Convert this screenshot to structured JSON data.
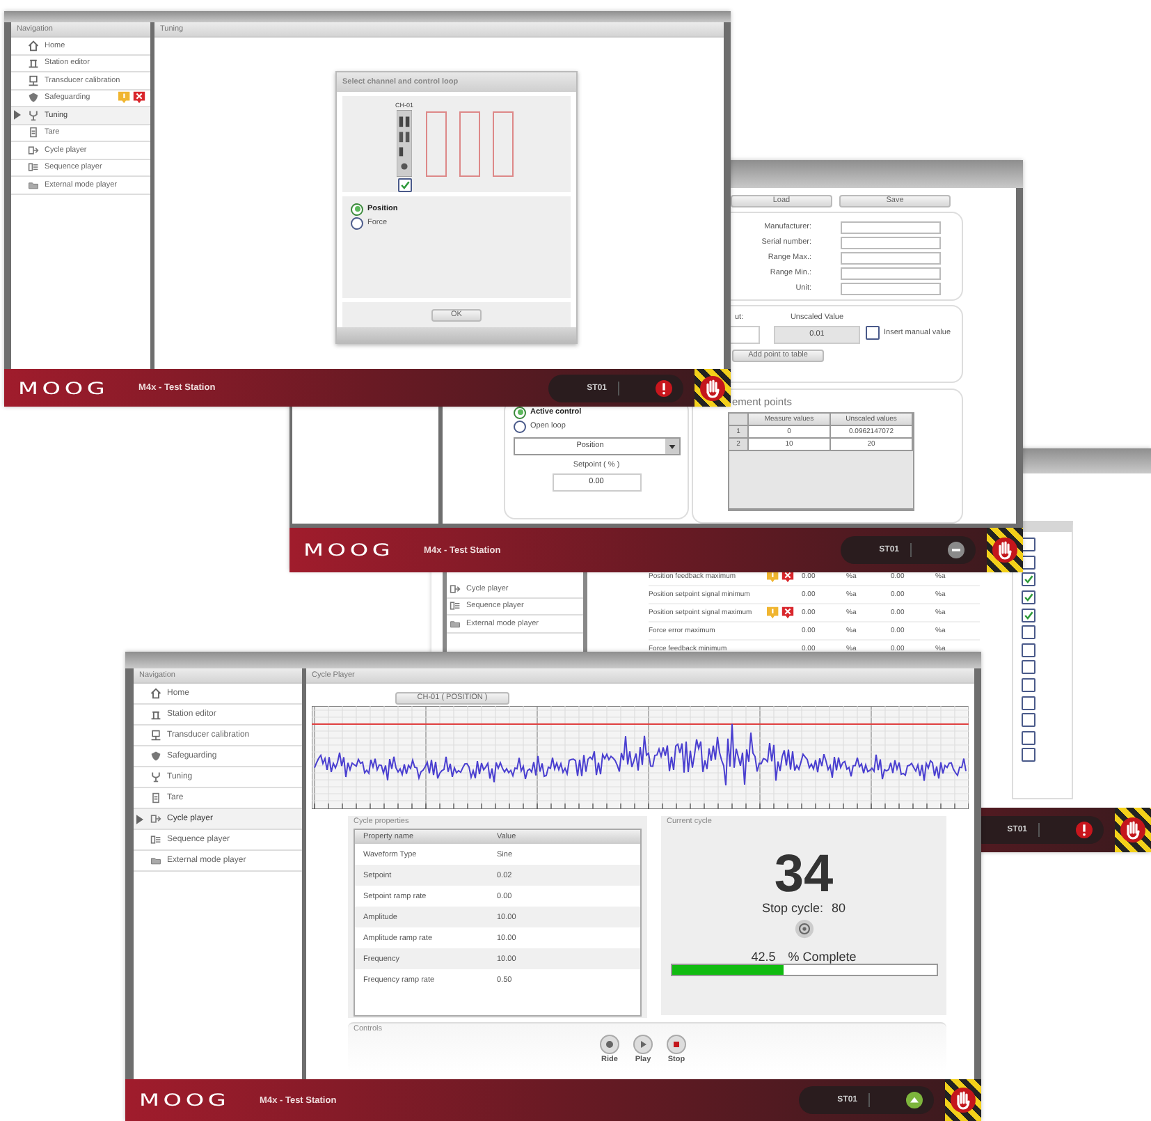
{
  "tuning_window": {
    "nav_title": "Navigation",
    "panel_title": "Tuning",
    "nav_items": [
      {
        "label": "Home",
        "selected": false,
        "alerts": false
      },
      {
        "label": "Station editor",
        "selected": false,
        "alerts": false
      },
      {
        "label": "Transducer calibration",
        "selected": false,
        "alerts": false
      },
      {
        "label": "Safeguarding",
        "selected": false,
        "alerts": true
      },
      {
        "label": "Tuning",
        "selected": true,
        "alerts": false
      },
      {
        "label": "Tare",
        "selected": false,
        "alerts": false
      },
      {
        "label": "Cycle player",
        "selected": false,
        "alerts": false
      },
      {
        "label": "Sequence player",
        "selected": false,
        "alerts": false
      },
      {
        "label": "External mode player",
        "selected": false,
        "alerts": false
      }
    ],
    "dialog": {
      "title": "Select channel and control loop",
      "channel": {
        "label": "CH-01",
        "checked": true
      },
      "radios": [
        {
          "label": "Position",
          "selected": true
        },
        {
          "label": "Force",
          "selected": false
        }
      ],
      "ok": "OK"
    },
    "footer": {
      "logo": "MOOG",
      "title": "M4x - Test Station",
      "station": "ST01",
      "kind": "alarm"
    }
  },
  "calibration_window": {
    "buttons": [
      "Load",
      "Save"
    ],
    "fields": [
      {
        "label": "Manufacturer:"
      },
      {
        "label": "Serial number:"
      },
      {
        "label": "Range Max.:"
      },
      {
        "label": "Range Min.:"
      },
      {
        "label": "Unit:"
      }
    ],
    "partial_label": "ut:",
    "unscaled_label": "Unscaled Value",
    "unscaled_value": "0.01",
    "manual": {
      "label": "Insert manual value",
      "checked": false
    },
    "add_button": "Add point to table",
    "points_title": "ement points",
    "columns": [
      "Measure values",
      "Unscaled values"
    ],
    "rows": [
      {
        "index": "1",
        "cells": [
          "0",
          "0.0962147072"
        ]
      },
      {
        "index": "2",
        "cells": [
          "10",
          "20"
        ]
      }
    ],
    "loop_radios": [
      {
        "label": "Active control",
        "selected": true
      },
      {
        "label": "Open loop",
        "selected": false
      }
    ],
    "loop_select": "Position",
    "setpoint_label": "Setpoint ( % )",
    "setpoint_value": "0.00",
    "footer": {
      "logo": "MOOG",
      "title": "M4x - Test Station",
      "station": "ST01",
      "kind": "idle"
    }
  },
  "safeguarding_window": {
    "nav_items": [
      {
        "label": "Cycle player"
      },
      {
        "label": "Sequence player"
      },
      {
        "label": "External mode player"
      }
    ],
    "rows": [
      {
        "name": "Position feedback maximum",
        "alerts": true,
        "values": [
          "0.00",
          "%a",
          "0.00",
          "%a"
        ]
      },
      {
        "name": "Position setpoint signal minimum",
        "alerts": false,
        "values": [
          "0.00",
          "%a",
          "0.00",
          "%a"
        ]
      },
      {
        "name": "Position setpoint signal maximum",
        "alerts": true,
        "values": [
          "0.00",
          "%a",
          "0.00",
          "%a"
        ]
      },
      {
        "name": "Force error maximum",
        "alerts": false,
        "values": [
          "0.00",
          "%a",
          "0.00",
          "%a"
        ]
      },
      {
        "name": "Force feedback minimum",
        "alerts": false,
        "values": [
          "0.00",
          "%a",
          "0.00",
          "%a"
        ]
      }
    ],
    "checks": [
      {
        "checked": false
      },
      {
        "checked": false
      },
      {
        "checked": true
      },
      {
        "checked": true
      },
      {
        "checked": true
      },
      {
        "checked": false
      },
      {
        "checked": false
      },
      {
        "checked": false
      },
      {
        "checked": false
      },
      {
        "checked": false
      },
      {
        "checked": false
      },
      {
        "checked": false
      },
      {
        "checked": false
      }
    ],
    "footer": {
      "station": "ST01",
      "kind": "alarm"
    }
  },
  "cycle_player_window": {
    "nav_title": "Navigation",
    "panel_title": "Cycle Player",
    "nav_items": [
      {
        "label": "Home",
        "selected": false
      },
      {
        "label": "Station editor",
        "selected": false
      },
      {
        "label": "Transducer calibration",
        "selected": false
      },
      {
        "label": "Safeguarding",
        "selected": false
      },
      {
        "label": "Tuning",
        "selected": false
      },
      {
        "label": "Tare",
        "selected": false
      },
      {
        "label": "Cycle player",
        "selected": true
      },
      {
        "label": "Sequence player",
        "selected": false
      },
      {
        "label": "External mode player",
        "selected": false
      }
    ],
    "channel_button": "CH-01 ( POSITION )",
    "properties_title": "Cycle properties",
    "columns": [
      "Property name",
      "Value"
    ],
    "properties": [
      {
        "name": "Waveform Type",
        "value": "Sine"
      },
      {
        "name": "Setpoint",
        "value": "0.02"
      },
      {
        "name": "Setpoint ramp rate",
        "value": "0.00"
      },
      {
        "name": "Amplitude",
        "value": "10.00"
      },
      {
        "name": "Amplitude ramp rate",
        "value": "10.00"
      },
      {
        "name": "Frequency",
        "value": "10.00"
      },
      {
        "name": "Frequency ramp rate",
        "value": "0.50"
      }
    ],
    "current_title": "Current cycle",
    "current_cycle": "34",
    "stop_label": "Stop cycle:",
    "stop_value": "80",
    "percent": "42.5",
    "percent_label": "% Complete",
    "progress": {
      "level": 0.425
    },
    "controls_title": "Controls",
    "controls": [
      {
        "label": "Ride",
        "kind": "record"
      },
      {
        "label": "Play",
        "kind": "play"
      },
      {
        "label": "Stop",
        "kind": "stop"
      }
    ],
    "footer": {
      "logo": "MOOG",
      "title": "M4x - Test Station",
      "station": "ST01",
      "kind": "running"
    }
  }
}
